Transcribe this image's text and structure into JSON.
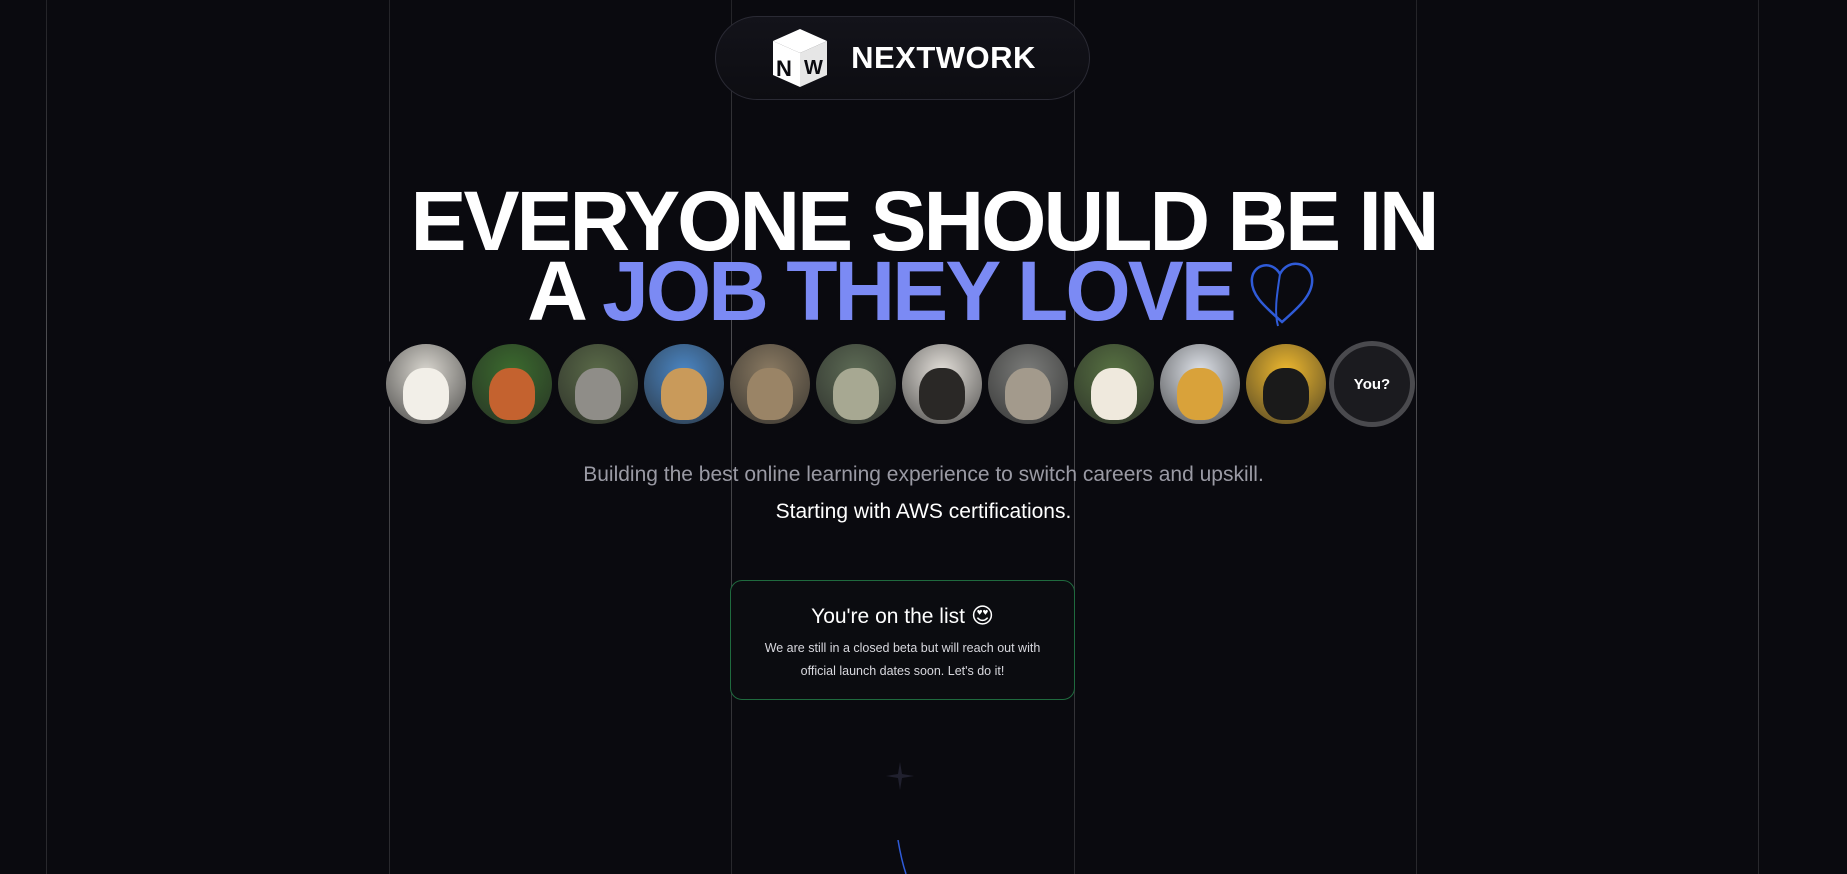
{
  "brand": {
    "name": "NEXTWORK",
    "logo_letters": [
      "N",
      "W"
    ]
  },
  "headline": {
    "line1": "EVERYONE SHOULD BE IN",
    "line2_prefix": "A",
    "line2_accent": "JOB THEY LOVE",
    "accent_color": "#7b8af4",
    "icon": "heart-outline-icon"
  },
  "avatars": {
    "items": [
      {
        "name": "avatar-fluffy-pug",
        "bg": "#d9d6cf",
        "fg": "#f2efe8"
      },
      {
        "name": "avatar-squirrel",
        "bg": "#3b6b2e",
        "fg": "#c4622f"
      },
      {
        "name": "avatar-koala",
        "bg": "#5a6a48",
        "fg": "#8f8d88"
      },
      {
        "name": "avatar-giraffe",
        "bg": "#4b86c4",
        "fg": "#c99a5a"
      },
      {
        "name": "avatar-cat",
        "bg": "#8a7a62",
        "fg": "#9a8466"
      },
      {
        "name": "avatar-blanket-creature",
        "bg": "#5d6b55",
        "fg": "#a7a892"
      },
      {
        "name": "avatar-pug-glasses",
        "bg": "#e4e0da",
        "fg": "#2a2826"
      },
      {
        "name": "avatar-seal",
        "bg": "#7b7c7a",
        "fg": "#a39a8c"
      },
      {
        "name": "avatar-llama",
        "bg": "#577142",
        "fg": "#efe9dd"
      },
      {
        "name": "avatar-pineapple",
        "bg": "#dfe3ea",
        "fg": "#d9a23a"
      },
      {
        "name": "avatar-black-pug",
        "bg": "#efb92f",
        "fg": "#1a1a1a"
      }
    ],
    "you_label": "You?"
  },
  "subtitle": {
    "line1": "Building the best online learning experience to switch careers and upskill.",
    "line2": "Starting with AWS certifications."
  },
  "waitlist_card": {
    "title": "You're on the list",
    "emoji": "😍",
    "body": "We are still in a closed beta but will reach out with official launch dates soon. Let's do it!",
    "border_color": "#1f6a3e"
  }
}
